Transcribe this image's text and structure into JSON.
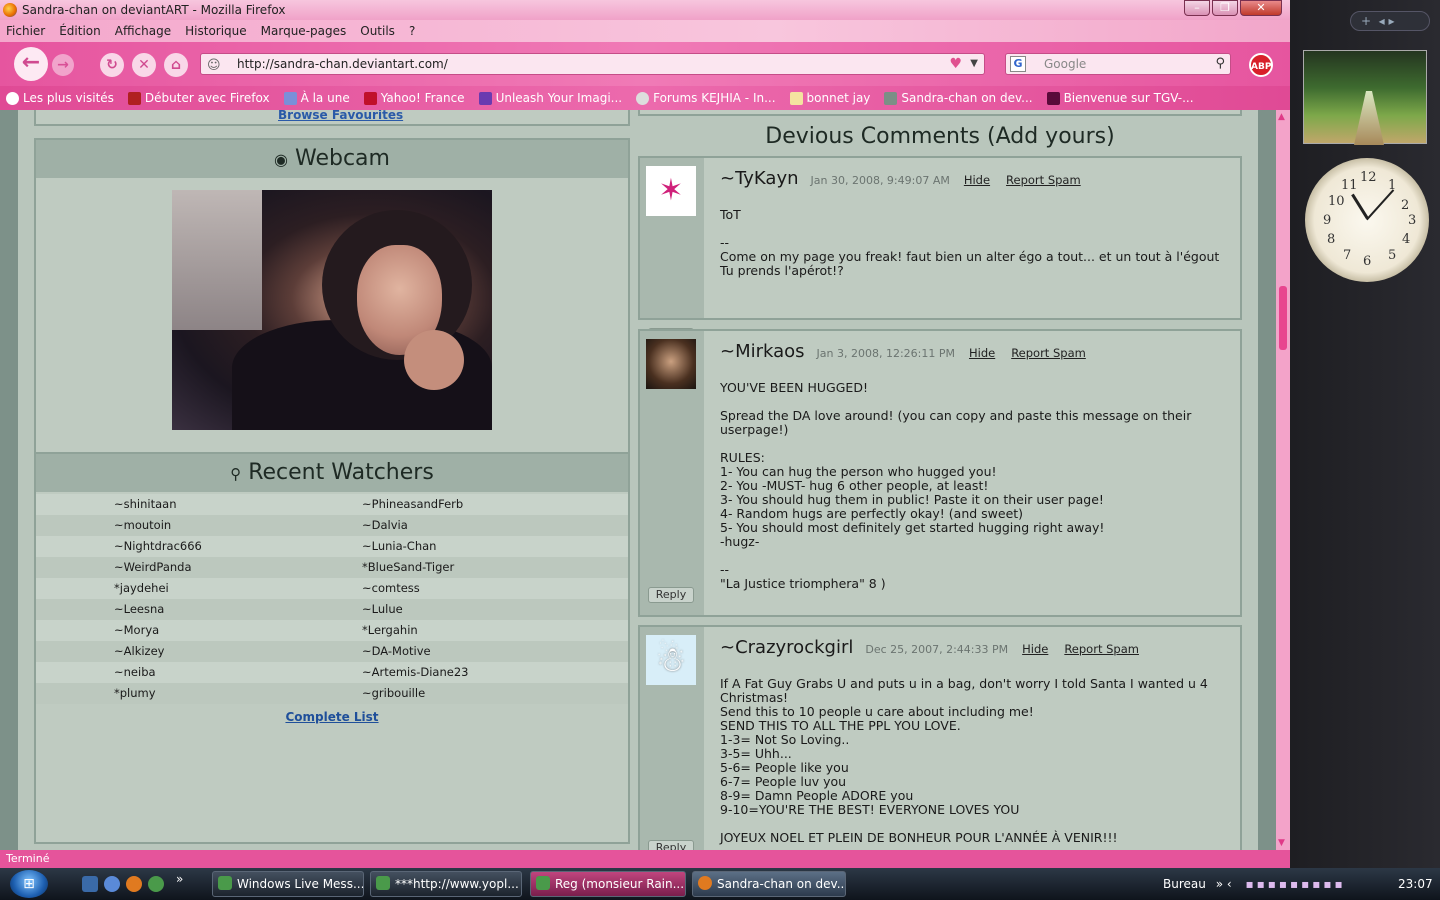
{
  "window": {
    "title": "Sandra-chan on deviantART - Mozilla Firefox"
  },
  "menu": [
    "Fichier",
    "Édition",
    "Affichage",
    "Historique",
    "Marque-pages",
    "Outils",
    "?"
  ],
  "url": "http://sandra-chan.deviantart.com/",
  "search": {
    "placeholder": "Google"
  },
  "abp": "ABP",
  "bookmarks": [
    "Les plus visités",
    "Débuter avec Firefox",
    "À la une",
    "Yahoo! France",
    "Unleash Your Imagi...",
    "Forums KEJHIA - In...",
    "bonnet jay",
    "Sandra-chan on dev...",
    "Bienvenue sur TGV-..."
  ],
  "status": "Terminé",
  "favourites": {
    "link": "Browse Favourites"
  },
  "webcam": {
    "title": "Webcam"
  },
  "watchers": {
    "title": "Recent Watchers",
    "rows": [
      [
        "~shinitaan",
        "~PhineasandFerb"
      ],
      [
        "~moutoin",
        "~Dalvia"
      ],
      [
        "~Nightdrac666",
        "~Lunia-Chan"
      ],
      [
        "~WeirdPanda",
        "*BlueSand-Tiger"
      ],
      [
        "*jaydehei",
        "~comtess"
      ],
      [
        "~Leesna",
        "~Lulue"
      ],
      [
        "~Morya",
        "*Lergahin"
      ],
      [
        "~Alkizey",
        "~DA-Motive"
      ],
      [
        "~neiba",
        "~Artemis-Diane23"
      ],
      [
        "*plumy",
        "~gribouille"
      ]
    ],
    "complete": "Complete List"
  },
  "comments": {
    "title": "Devious Comments (Add yours)",
    "hide": "Hide",
    "spam": "Report Spam",
    "reply": "Reply",
    "items": [
      {
        "user": "~TyKayn",
        "date": "Jan 30, 2008, 9:49:07 AM",
        "text": "ToT\n\n--\nCome on my page you freak! faut bien un alter égo a tout... et un tout à l'égout Tu prends l'apérot!?"
      },
      {
        "user": "~Mirkaos",
        "date": "Jan 3, 2008, 12:26:11 PM",
        "text": "YOU'VE BEEN HUGGED!\n\nSpread the DA love around! (you can copy and paste this message on their userpage!)\n\nRULES:\n1- You can hug the person who hugged you!\n2- You -MUST- hug 6 other people, at least!\n3- You should hug them in public! Paste it on their user page!\n4- Random hugs are perfectly okay! (and sweet)\n5- You should most definitely get started hugging right away!\n-hugz-\n\n--\n\"La Justice triomphera\" 8 )"
      },
      {
        "user": "~Crazyrockgirl",
        "date": "Dec 25, 2007, 2:44:33 PM",
        "text": "If A Fat Guy Grabs U and puts u in a bag, don't worry I told Santa I wanted u 4 Christmas!\nSend this to 10 people u care about including me!\nSEND THIS TO ALL THE PPL YOU LOVE.\n1-3= Not So Loving..\n3-5= Uhh...\n5-6= People like you\n6-7= People luv you\n8-9= Damn People ADORE you\n9-10=YOU'RE THE BEST! EVERYONE LOVES YOU\n\nJOYEUX NOEL ET PLEIN DE BONHEUR POUR L'ANNÉE À VENIR!!!"
      }
    ]
  },
  "taskbar": {
    "tasks": [
      "Windows Live Mess...",
      "***http://www.yopl...",
      "Reg (monsieur Rain...",
      "Sandra-chan on dev..."
    ],
    "desktop": "Bureau",
    "time": "23:07"
  },
  "clock_numbers": [
    "12",
    "1",
    "2",
    "3",
    "4",
    "5",
    "6",
    "7",
    "8",
    "9",
    "10",
    "11"
  ],
  "colors": {
    "accent": "#e5549b",
    "page_bg": "#b9c6bc",
    "box_head": "#9fb0a6"
  }
}
